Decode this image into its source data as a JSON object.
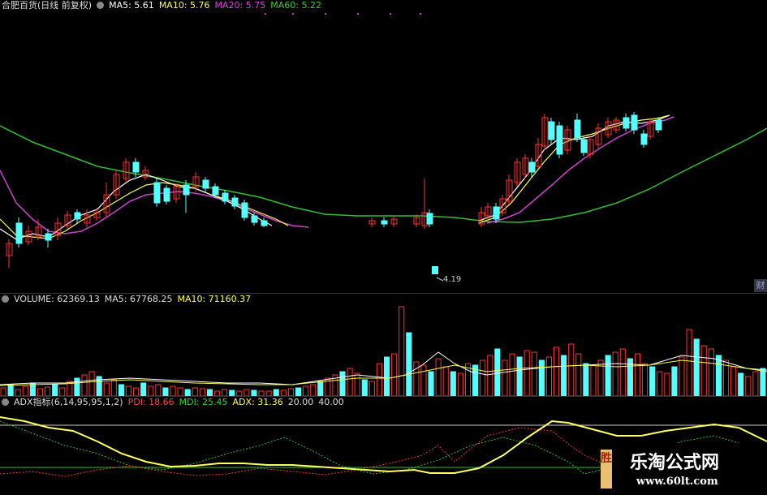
{
  "price_legend": {
    "stock": "合肥百货(日线 前复权)",
    "ma5": "MA5: 5.61",
    "ma10": "MA10: 5.76",
    "ma20": "MA20: 5.75",
    "ma60": "MA60: 5.22"
  },
  "price_low_label": "4.19",
  "side_tab": "财",
  "volume_legend": {
    "volume": "VOLUME: 62369.13",
    "ma5": "MA5: 67768.25",
    "ma10": "MA10: 71160.37"
  },
  "adx_legend": {
    "name": "ADX指标(6,14,95,95,1,2)",
    "pdi": "PDI: 18.66",
    "mdi": "MDI: 25.45",
    "adx": "ADX: 31.36",
    "level1": "20.00",
    "level2": "40.00"
  },
  "watermark": {
    "strip": "胜",
    "title": "乐淘公式网",
    "url": "www.60lt.com"
  },
  "colors": {
    "up": "#ff3030",
    "down": "#54ffff",
    "ma5": "#ffffff",
    "ma10": "#ffff40",
    "ma20": "#d040d0",
    "ma60": "#30c030",
    "adx": "#ffff60",
    "pdi": "#ff3030",
    "mdi": "#30c030"
  }
}
